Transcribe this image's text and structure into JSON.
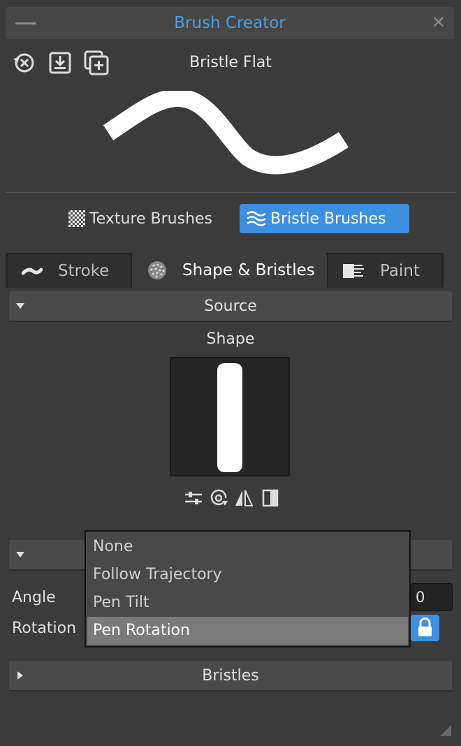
{
  "window": {
    "title": "Brush Creator"
  },
  "toolbar": {
    "brush_name": "Bristle Flat",
    "icons": [
      "reset-icon",
      "import-icon",
      "duplicate-icon"
    ]
  },
  "categories": {
    "texture_label": "Texture Brushes",
    "bristle_label": "Bristle Brushes",
    "active": "bristle"
  },
  "tabs": [
    {
      "label": "Stroke",
      "icon": "stroke-icon"
    },
    {
      "label": "Shape & Bristles",
      "icon": "shape-icon",
      "active": true
    },
    {
      "label": "Paint",
      "icon": "paint-icon"
    }
  ],
  "source_section": {
    "title": "Source",
    "shape_label": "Shape",
    "shape_tools": [
      "adjust-icon",
      "spiral-icon",
      "flip-icon",
      "invert-icon"
    ]
  },
  "orientation": {
    "angle_label": "Angle",
    "angle_value": "0",
    "rotation_label": "Rotation",
    "lock_icon": "lock-icon"
  },
  "rotation_dropdown": {
    "options": [
      "None",
      "Follow Trajectory",
      "Pen Tilt",
      "Pen Rotation"
    ],
    "selected": "Pen Rotation"
  },
  "bristles_section": {
    "title": "Bristles"
  },
  "colors": {
    "accent": "#3d8fe0",
    "title": "#4a9fe6",
    "panel": "#3b3b3b"
  }
}
